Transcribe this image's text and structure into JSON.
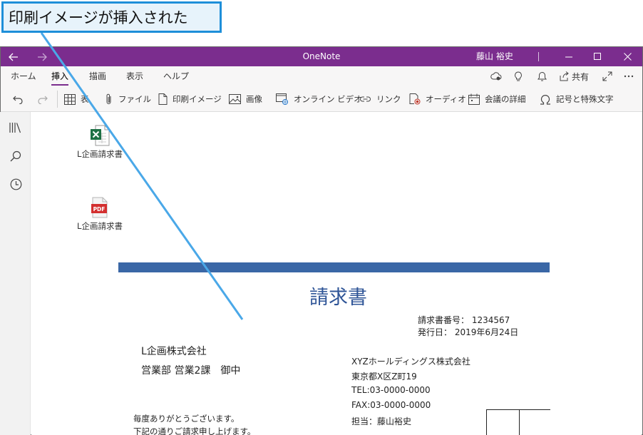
{
  "callout": {
    "text": "印刷イメージが挿入された"
  },
  "titlebar": {
    "app_title": "OneNote",
    "user_name": "藤山 裕史",
    "back_icon": "arrow-left-icon",
    "forward_icon": "arrow-right-icon"
  },
  "menu": {
    "tabs": [
      "ホーム",
      "挿入",
      "描画",
      "表示",
      "ヘルプ"
    ],
    "active_tab": "挿入",
    "share_label": "共有"
  },
  "toolbar": {
    "table": "表",
    "file": "ファイル",
    "printout": "印刷イメージ",
    "picture": "画像",
    "online_video": "オンライン ビデオ",
    "link": "リンク",
    "audio": "オーディオ",
    "meeting_details": "会議の詳細",
    "symbol": "記号と特殊文字"
  },
  "page": {
    "attachments": [
      {
        "label": "L企画請求書",
        "type": "excel"
      },
      {
        "label": "L企画請求書",
        "type": "pdf"
      }
    ],
    "invoice": {
      "title": "請求書",
      "number_label": "請求書番号：",
      "number": "1234567",
      "date_label": "発行日：",
      "date": "2019年6月24日",
      "recipient_company": "L企画株式会社",
      "recipient_dept": "営業部 営業2課　御中",
      "sender_company": "XYZホールディングス株式会社",
      "sender_address": "東京都X区Z町19",
      "sender_tel": "TEL:03-0000-0000",
      "sender_fax": "FAX:03-0000-0000",
      "sender_person": "担当：藤山裕史",
      "greeting_1": "毎度ありがとうございます。",
      "greeting_2": "下記の通りご請求申し上げます。"
    }
  },
  "colors": {
    "titlebar": "#7b2d8e",
    "callout_border": "#1e8fd9",
    "callout_fill": "#e7f3fb",
    "invoice_bar": "#3a67a6",
    "invoice_title": "#2f5597"
  }
}
